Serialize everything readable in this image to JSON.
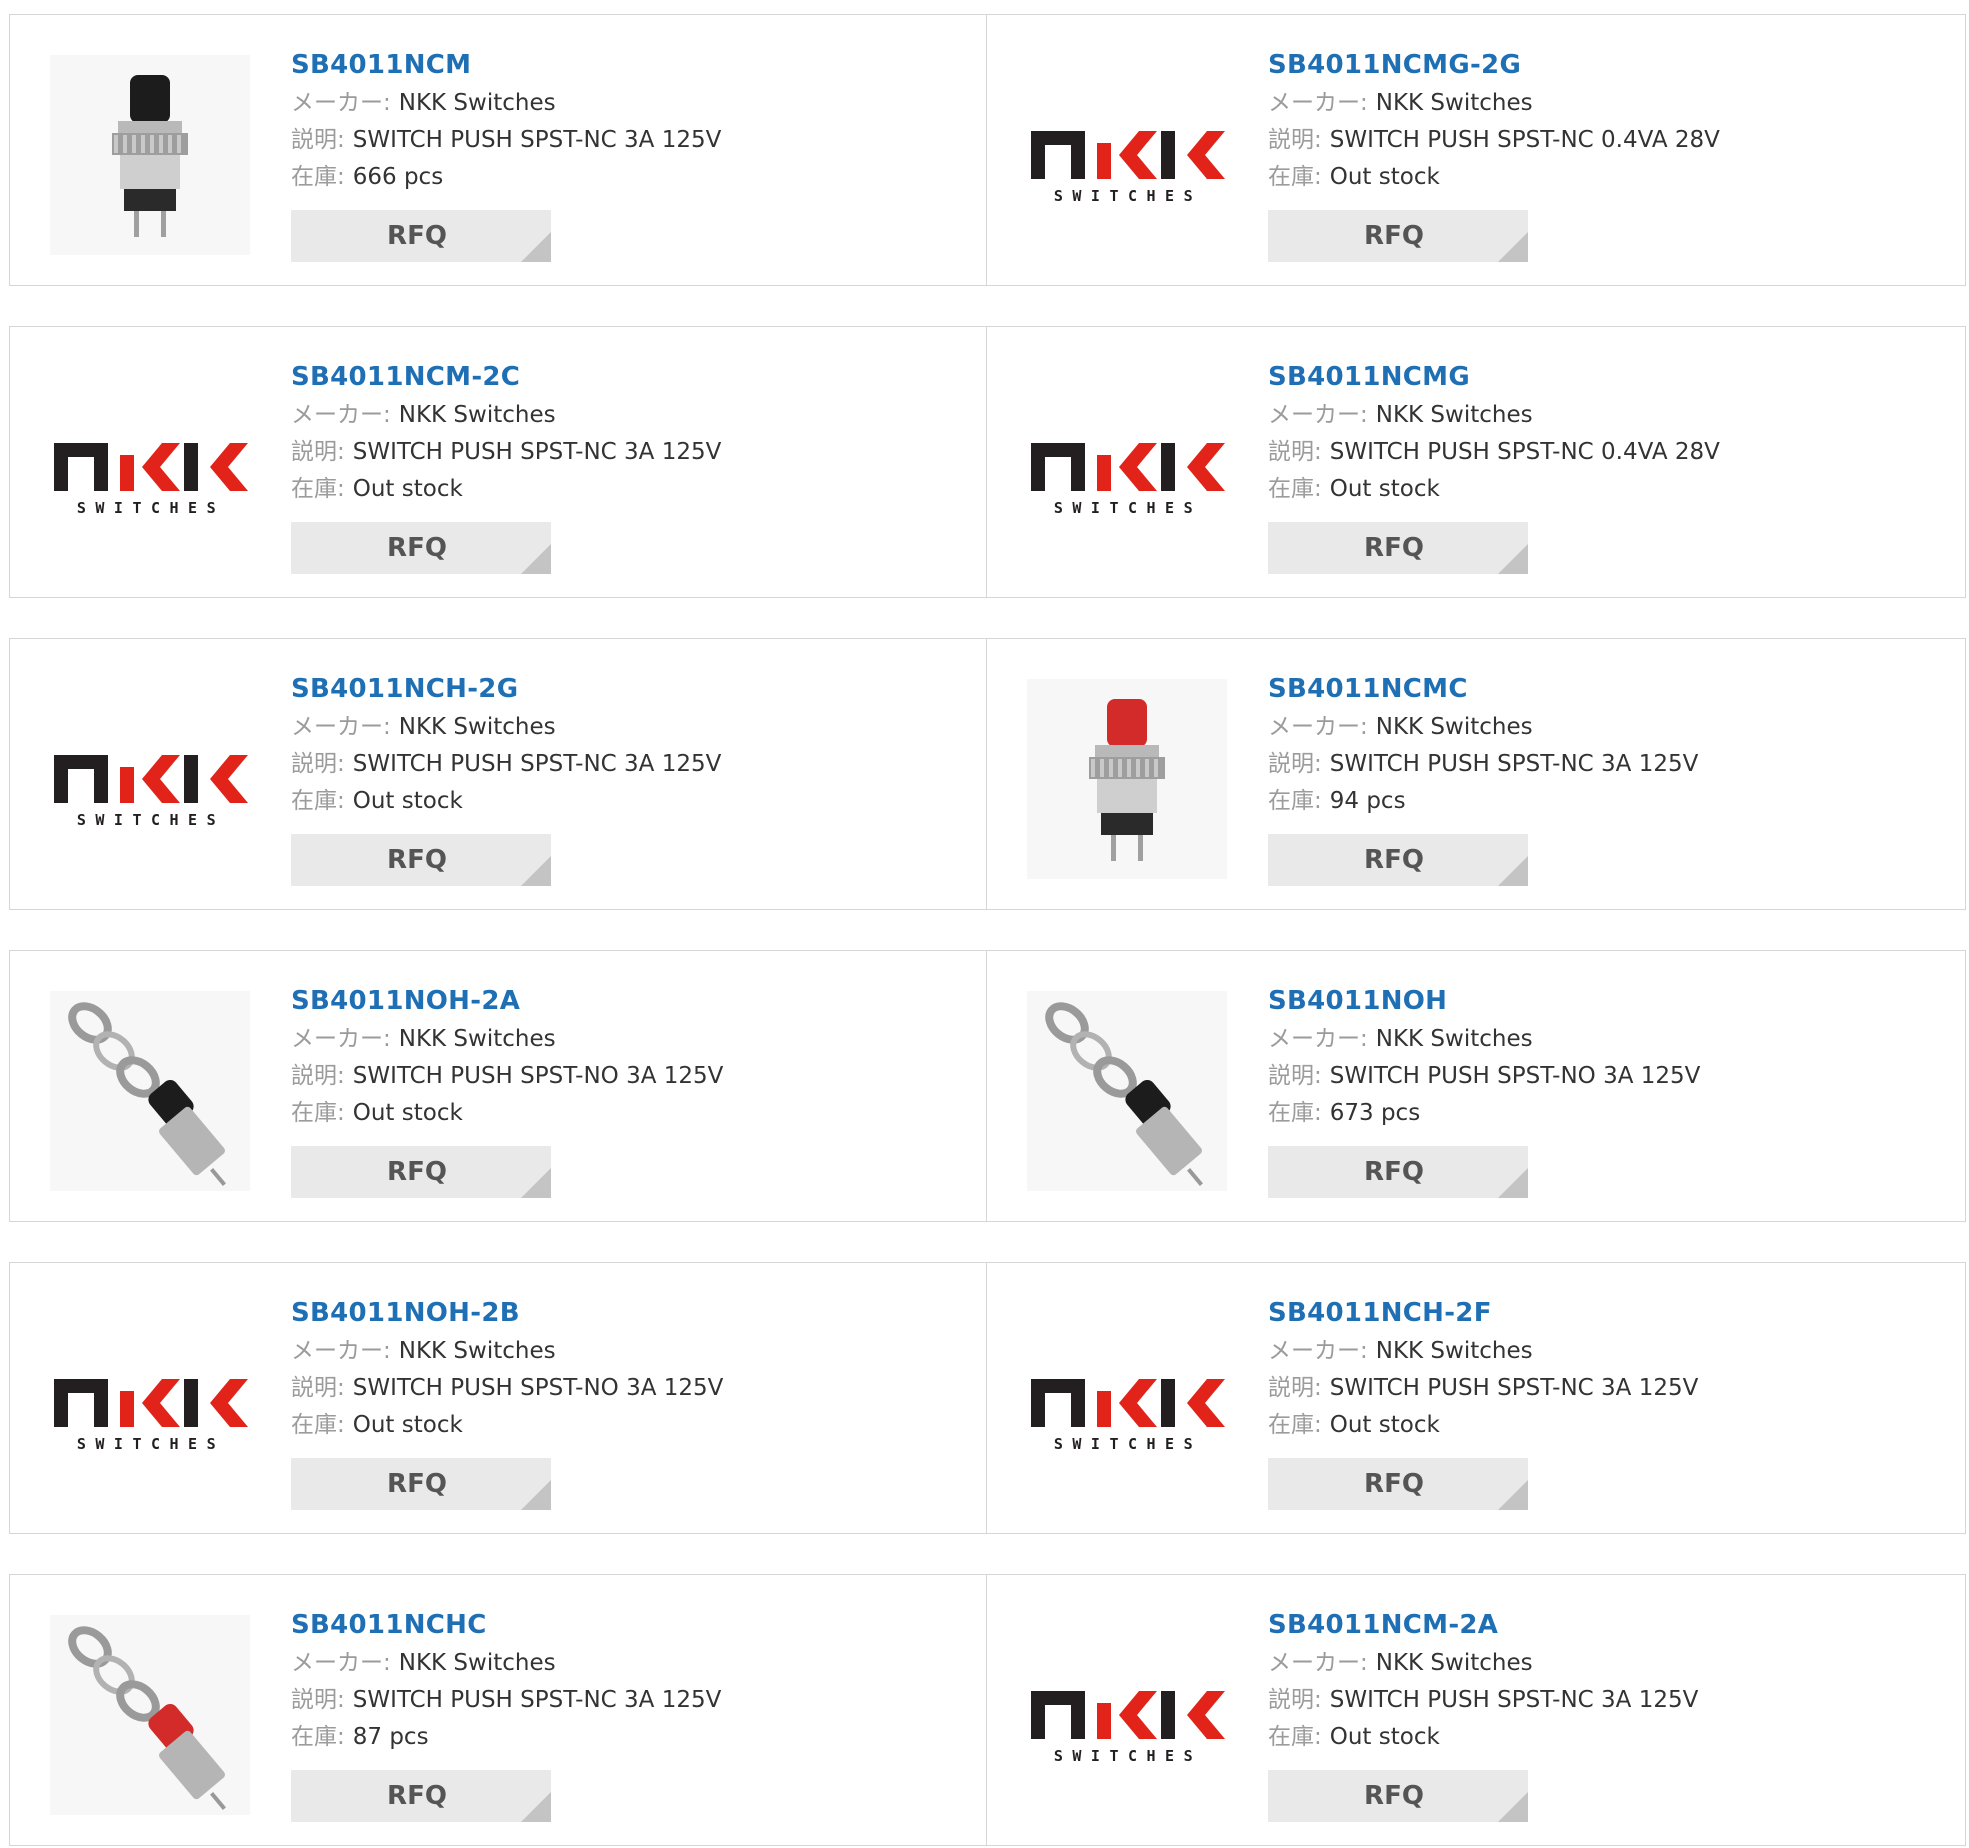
{
  "labels": {
    "maker": "メーカー:",
    "desc": "説明:",
    "stock": "在庫:",
    "rfq": "RFQ"
  },
  "logo_text": {
    "brand": "NKK",
    "sub": "SWITCHES"
  },
  "colors": {
    "title": "#1f6fb4",
    "logo_dark": "#231f20",
    "logo_red": "#e2231a"
  },
  "products": [
    {
      "part": "SB4011NCM",
      "maker": "NKK Switches",
      "desc": "SWITCH PUSH SPST-NC 3A 125V",
      "stock": "666 pcs",
      "image": "black-pushbutton-photo"
    },
    {
      "part": "SB4011NCMG-2G",
      "maker": "NKK Switches",
      "desc": "SWITCH PUSH SPST-NC 0.4VA 28V",
      "stock": "Out stock",
      "image": "nkk-logo"
    },
    {
      "part": "SB4011NCM-2C",
      "maker": "NKK Switches",
      "desc": "SWITCH PUSH SPST-NC 3A 125V",
      "stock": "Out stock",
      "image": "nkk-logo"
    },
    {
      "part": "SB4011NCMG",
      "maker": "NKK Switches",
      "desc": "SWITCH PUSH SPST-NC 0.4VA 28V",
      "stock": "Out stock",
      "image": "nkk-logo"
    },
    {
      "part": "SB4011NCH-2G",
      "maker": "NKK Switches",
      "desc": "SWITCH PUSH SPST-NC 3A 125V",
      "stock": "Out stock",
      "image": "nkk-logo"
    },
    {
      "part": "SB4011NCMC",
      "maker": "NKK Switches",
      "desc": "SWITCH PUSH SPST-NC 3A 125V",
      "stock": "94 pcs",
      "image": "red-pushbutton-photo"
    },
    {
      "part": "SB4011NOH-2A",
      "maker": "NKK Switches",
      "desc": "SWITCH PUSH SPST-NO 3A 125V",
      "stock": "Out stock",
      "image": "black-exploded-photo"
    },
    {
      "part": "SB4011NOH",
      "maker": "NKK Switches",
      "desc": "SWITCH PUSH SPST-NO 3A 125V",
      "stock": "673 pcs",
      "image": "black-exploded-photo"
    },
    {
      "part": "SB4011NOH-2B",
      "maker": "NKK Switches",
      "desc": "SWITCH PUSH SPST-NO 3A 125V",
      "stock": "Out stock",
      "image": "nkk-logo"
    },
    {
      "part": "SB4011NCH-2F",
      "maker": "NKK Switches",
      "desc": "SWITCH PUSH SPST-NC 3A 125V",
      "stock": "Out stock",
      "image": "nkk-logo"
    },
    {
      "part": "SB4011NCHC",
      "maker": "NKK Switches",
      "desc": "SWITCH PUSH SPST-NC 3A 125V",
      "stock": "87 pcs",
      "image": "red-exploded-photo"
    },
    {
      "part": "SB4011NCM-2A",
      "maker": "NKK Switches",
      "desc": "SWITCH PUSH SPST-NC 3A 125V",
      "stock": "Out stock",
      "image": "nkk-logo"
    }
  ]
}
